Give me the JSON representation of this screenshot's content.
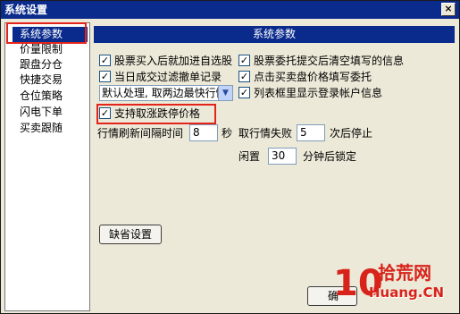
{
  "window": {
    "title": "系统设置",
    "close_glyph": "×"
  },
  "sidebar": {
    "items": [
      {
        "label": "系统参数",
        "active": true
      },
      {
        "label": "价量限制",
        "active": false
      },
      {
        "label": "跟盘分仓",
        "active": false
      },
      {
        "label": "快捷交易",
        "active": false
      },
      {
        "label": "仓位策略",
        "active": false
      },
      {
        "label": "闪电下单",
        "active": false
      },
      {
        "label": "买卖跟随",
        "active": false
      }
    ]
  },
  "panel": {
    "header": "系统参数",
    "checkboxes": [
      {
        "label": "股票买入后就加进自选股",
        "checked": true
      },
      {
        "label": "当日成交过滤撤单记录",
        "checked": true
      },
      {
        "label": "股票委托提交后清空填写的信息",
        "checked": true
      },
      {
        "label": "点击买卖盘价格填写委托",
        "checked": true
      },
      {
        "label": "列表框里显示登录帐户信息",
        "checked": true
      },
      {
        "label": "支持取涨跌停价格",
        "checked": true
      }
    ],
    "dropdown_value": "默认处理, 取两边最快行情",
    "refresh": {
      "label": "行情刷新间隔时间",
      "value": "8",
      "unit": "秒"
    },
    "fail": {
      "label": "取行情失败",
      "value": "5",
      "unit": "次后停止"
    },
    "idle": {
      "label": "闲置",
      "value": "30",
      "unit": "分钟后锁定"
    },
    "default_button": "缺省设置",
    "ok_button": "确"
  },
  "watermark": {
    "brand_cn": "拾荒网",
    "url": "Huang.CN",
    "logo_text": "10"
  },
  "colors": {
    "title_blue": "#0a2a8c",
    "highlight_red": "#e3241b",
    "dialog_bg": "#ece9d8"
  }
}
